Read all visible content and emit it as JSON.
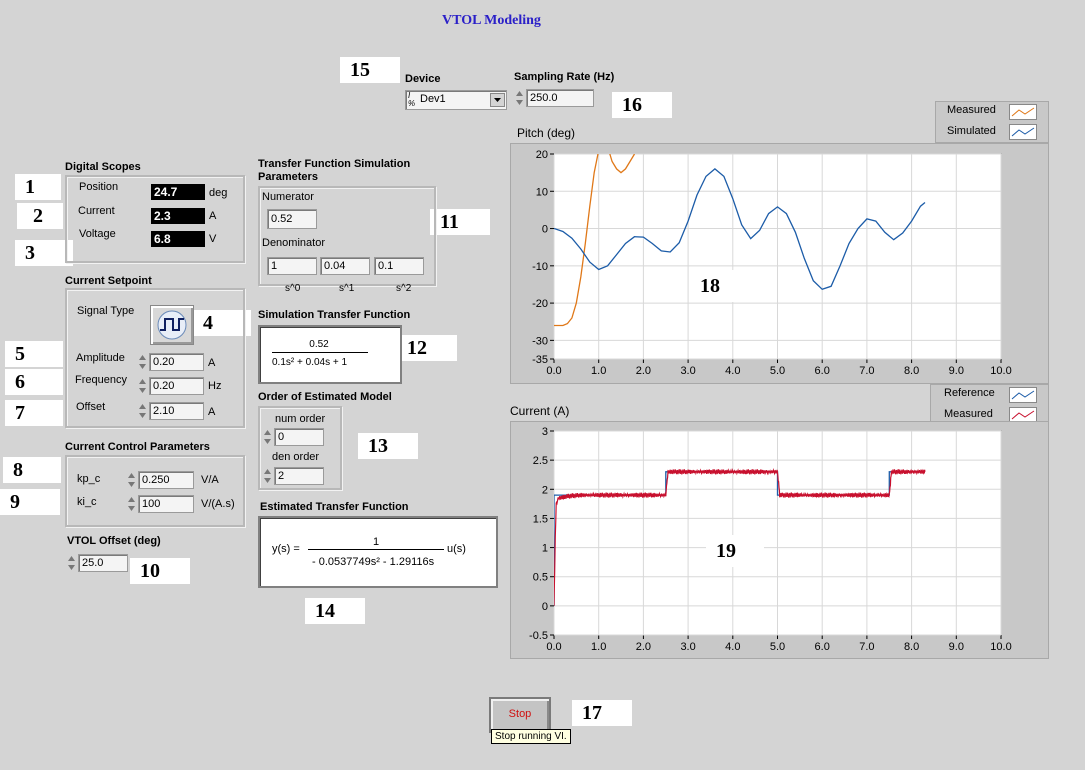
{
  "title": "VTOL Modeling",
  "markers": [
    "1",
    "2",
    "3",
    "4",
    "5",
    "6",
    "7",
    "8",
    "9",
    "10",
    "11",
    "12",
    "13",
    "14",
    "15",
    "16",
    "17",
    "18",
    "19"
  ],
  "device": {
    "label": "Device",
    "io_prefix": "I/O",
    "value": "Dev1"
  },
  "sampling": {
    "label": "Sampling Rate (Hz)",
    "value": "250.0"
  },
  "scopes": {
    "title": "Digital Scopes",
    "position": {
      "label": "Position",
      "value": "24.7",
      "unit": "deg"
    },
    "current": {
      "label": "Current",
      "value": "2.3",
      "unit": "A"
    },
    "voltage": {
      "label": "Voltage",
      "value": "6.8",
      "unit": "V"
    }
  },
  "setpoint": {
    "title": "Current Setpoint",
    "signal_type_label": "Signal Type",
    "amplitude": {
      "label": "Amplitude",
      "value": "0.20",
      "unit": "A"
    },
    "frequency": {
      "label": "Frequency",
      "value": "0.20",
      "unit": "Hz"
    },
    "offset": {
      "label": "Offset",
      "value": "2.10",
      "unit": "A"
    }
  },
  "control": {
    "title": "Current Control Parameters",
    "kp": {
      "label": "kp_c",
      "value": "0.250",
      "unit": "V/A"
    },
    "ki": {
      "label": "ki_c",
      "value": "100",
      "unit": "V/(A.s)"
    }
  },
  "vtol_offset": {
    "label": "VTOL Offset (deg)",
    "value": "25.0"
  },
  "tfsim": {
    "title": "Transfer Function Simulation Parameters",
    "numerator_label": "Numerator",
    "numerator": "0.52",
    "denominator_label": "Denominator",
    "den": [
      "1",
      "0.04",
      "0.1"
    ],
    "powers": [
      "s^0",
      "s^1",
      "s^2"
    ]
  },
  "simtf": {
    "title": "Simulation Transfer Function",
    "num": "0.52",
    "den": "0.1s² + 0.04s + 1"
  },
  "order": {
    "title": "Order of Estimated Model",
    "num_label": "num order",
    "num_value": "0",
    "den_label": "den order",
    "den_value": "2"
  },
  "esttf": {
    "title": "Estimated Transfer Function",
    "lhs": "y(s) =",
    "num": "1",
    "den": "- 0.0537749s² - 1.29116s",
    "rhs": "u(s)"
  },
  "stop": {
    "label": "Stop",
    "tooltip": "Stop running VI."
  },
  "colors": {
    "orange": "#e07818",
    "blue": "#1c5ca8",
    "red": "#c8102e",
    "title": "#2a1fc8"
  },
  "chart_data": [
    {
      "type": "line",
      "title": "Pitch (deg)",
      "xlim": [
        0,
        10
      ],
      "ylim": [
        -35,
        20
      ],
      "xticks": [
        "0.0",
        "1.0",
        "2.0",
        "3.0",
        "4.0",
        "5.0",
        "6.0",
        "7.0",
        "8.0",
        "9.0",
        "10.0"
      ],
      "yticks": [
        "20",
        "10",
        "0",
        "-10",
        "-20",
        "-30",
        "-35"
      ],
      "grid": true,
      "legend": [
        "Measured",
        "Simulated"
      ],
      "series": [
        {
          "name": "Measured",
          "color": "#e07818",
          "x": [
            0.0,
            0.1,
            0.2,
            0.3,
            0.4,
            0.5,
            0.6,
            0.7,
            0.8,
            0.9,
            1.0,
            1.05,
            1.1,
            1.2,
            1.3,
            1.4,
            1.5,
            1.6,
            1.7,
            1.8
          ],
          "y": [
            -26,
            -26,
            -26,
            -25.5,
            -24,
            -20,
            -13,
            -4,
            6,
            15,
            21,
            22,
            23,
            22,
            18,
            16,
            15,
            16,
            18,
            20
          ]
        },
        {
          "name": "Simulated",
          "color": "#1c5ca8",
          "x": [
            0.0,
            0.2,
            0.4,
            0.6,
            0.8,
            1.0,
            1.2,
            1.4,
            1.6,
            1.8,
            2.0,
            2.2,
            2.4,
            2.6,
            2.8,
            3.0,
            3.2,
            3.4,
            3.6,
            3.8,
            4.0,
            4.2,
            4.4,
            4.6,
            4.8,
            5.0,
            5.2,
            5.4,
            5.6,
            5.8,
            6.0,
            6.2,
            6.4,
            6.6,
            6.8,
            7.0,
            7.2,
            7.4,
            7.6,
            7.8,
            8.0,
            8.2,
            8.3
          ],
          "y": [
            0,
            -0.8,
            -2.6,
            -5.5,
            -9,
            -11,
            -10,
            -7,
            -4,
            -2.2,
            -2.3,
            -4,
            -6,
            -6.3,
            -3.8,
            2,
            9,
            14,
            16,
            14,
            8,
            1,
            -2.7,
            -0.5,
            4,
            5.8,
            4,
            -1,
            -8,
            -14,
            -16.3,
            -15.5,
            -10,
            -4,
            0,
            2.6,
            2,
            -1,
            -3,
            -1.2,
            2,
            6,
            7
          ]
        }
      ]
    },
    {
      "type": "line",
      "title": "Current (A)",
      "xlim": [
        0,
        10
      ],
      "ylim": [
        -0.5,
        3
      ],
      "xticks": [
        "0.0",
        "1.0",
        "2.0",
        "3.0",
        "4.0",
        "5.0",
        "6.0",
        "7.0",
        "8.0",
        "9.0",
        "10.0"
      ],
      "yticks": [
        "3",
        "2.5",
        "2",
        "1.5",
        "1",
        "0.5",
        "0",
        "-0.5"
      ],
      "grid": true,
      "legend": [
        "Reference",
        "Measured"
      ],
      "series": [
        {
          "name": "Reference",
          "color": "#1c5ca8",
          "x": [
            0.0,
            0.0,
            2.5,
            2.5,
            5.0,
            5.0,
            7.5,
            7.5,
            8.3
          ],
          "y": [
            0,
            1.9,
            1.9,
            2.3,
            2.3,
            1.9,
            1.9,
            2.3,
            2.3
          ]
        },
        {
          "name": "Measured",
          "color": "#c8102e",
          "x": [
            0.0,
            0.03,
            0.05,
            0.1,
            0.3,
            0.6,
            1.0,
            1.5,
            2.0,
            2.5,
            2.55,
            3.0,
            3.5,
            4.0,
            4.5,
            5.0,
            5.05,
            5.5,
            6.0,
            6.5,
            7.0,
            7.5,
            7.55,
            8.0,
            8.3
          ],
          "y": [
            0,
            1.2,
            1.75,
            1.85,
            1.88,
            1.9,
            1.9,
            1.9,
            1.9,
            1.9,
            2.3,
            2.3,
            2.3,
            2.3,
            2.3,
            2.3,
            1.9,
            1.9,
            1.9,
            1.9,
            1.9,
            1.9,
            2.3,
            2.3,
            2.3
          ]
        }
      ]
    }
  ]
}
